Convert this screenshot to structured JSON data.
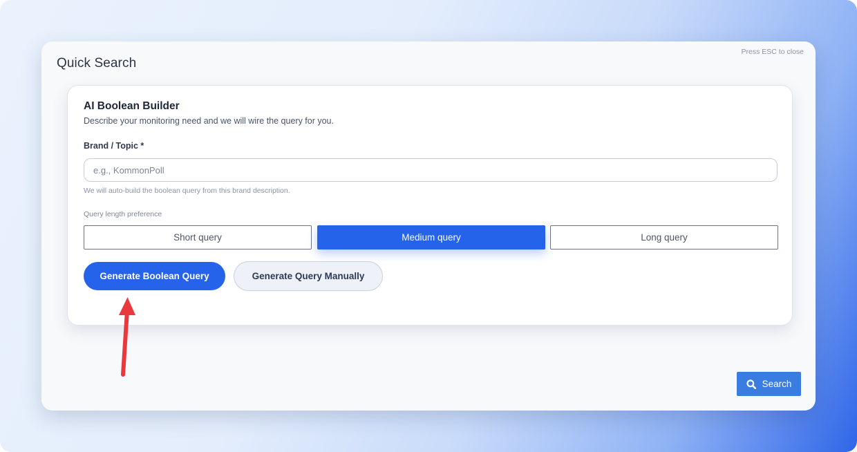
{
  "modal": {
    "title": "Quick Search",
    "esc_hint": "Press ESC to close",
    "search_button": "Search"
  },
  "builder": {
    "title": "AI Boolean Builder",
    "subtitle": "Describe your monitoring need and we will wire the query for you.",
    "field_label": "Brand / Topic *",
    "field_value": "",
    "field_placeholder": "e.g., KommonPoll",
    "helper_text": "We will auto-build the boolean query from this brand description.",
    "preference_label": "Query length preference",
    "options": [
      "Short query",
      "Medium query",
      "Long query"
    ],
    "selected_option": "Medium query",
    "generate_button": "Generate Boolean Query",
    "manual_button": "Generate Query Manually"
  },
  "colors": {
    "accent": "#2563eb",
    "search_button": "#3a7ce0",
    "annotation_arrow": "#e8393f"
  },
  "icons": {
    "search": "magnifier-icon",
    "annotation": "red-arrow-pointer"
  }
}
